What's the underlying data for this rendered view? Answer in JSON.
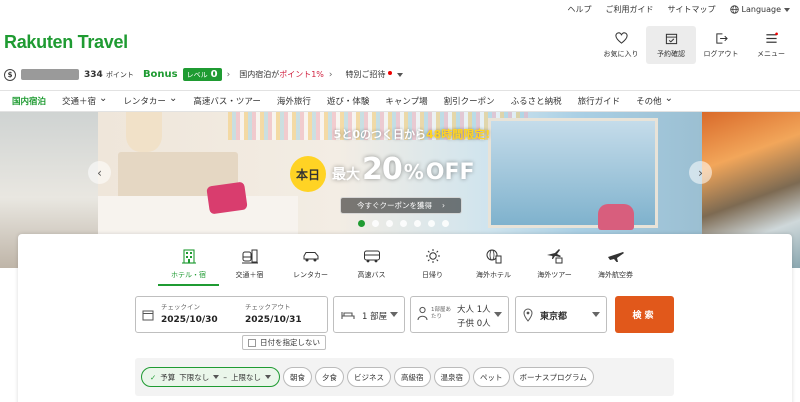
{
  "util_links": [
    "ヘルプ",
    "ご利用ガイド",
    "サイトマップ"
  ],
  "language_label": "Language",
  "logo_text": "Rakuten Travel",
  "header_buttons": [
    {
      "label": "お気に入り",
      "icon": "heart-icon"
    },
    {
      "label": "予約確認",
      "icon": "calendar-check-icon"
    },
    {
      "label": "ログアウト",
      "icon": "logout-icon"
    },
    {
      "label": "メニュー",
      "icon": "menu-icon"
    }
  ],
  "points": {
    "coin_symbol": "$",
    "value": "334",
    "unit": "ポイント",
    "bonus_label": "Bonus",
    "level_label": "レベル",
    "level_value": "0",
    "promo_prefix": "国内宿泊が",
    "promo_highlight": "ポイント1%",
    "invite_label": "特別ご招待"
  },
  "nav_items": [
    {
      "label": "国内宿泊",
      "active": true,
      "dropdown": false
    },
    {
      "label": "交通＋宿",
      "active": false,
      "dropdown": true
    },
    {
      "label": "レンタカー",
      "active": false,
      "dropdown": true
    },
    {
      "label": "高速バス・ツアー",
      "active": false,
      "dropdown": false
    },
    {
      "label": "海外旅行",
      "active": false,
      "dropdown": false
    },
    {
      "label": "遊び・体験",
      "active": false,
      "dropdown": false
    },
    {
      "label": "キャンプ場",
      "active": false,
      "dropdown": false
    },
    {
      "label": "割引クーポン",
      "active": false,
      "dropdown": false
    },
    {
      "label": "ふるさと納税",
      "active": false,
      "dropdown": false
    },
    {
      "label": "旅行ガイド",
      "active": false,
      "dropdown": false
    },
    {
      "label": "その他",
      "active": false,
      "dropdown": true
    }
  ],
  "banner": {
    "headline_prefix": "5と0のつく日から",
    "headline_highlight": "48時間限定!",
    "today_badge": "本日",
    "max_label": "最大",
    "discount_number": "20",
    "discount_percent": "%",
    "discount_off": "OFF",
    "cta_label": "今すぐクーポンを獲得",
    "slide_count": 7,
    "active_slide": 1
  },
  "search_tabs": [
    {
      "label": "ホテル・宿",
      "icon": "hotel-icon",
      "active": true
    },
    {
      "label": "交通＋宿",
      "icon": "train-hotel-icon",
      "active": false
    },
    {
      "label": "レンタカー",
      "icon": "car-icon",
      "active": false
    },
    {
      "label": "高速バス",
      "icon": "bus-icon",
      "active": false
    },
    {
      "label": "日帰り",
      "icon": "sun-icon",
      "active": false
    },
    {
      "label": "海外ホテル",
      "icon": "globe-hotel-icon",
      "active": false
    },
    {
      "label": "海外ツアー",
      "icon": "plane-hotel-icon",
      "active": false
    },
    {
      "label": "海外航空券",
      "icon": "plane-icon",
      "active": false
    }
  ],
  "search": {
    "checkin_label": "チェックイン",
    "checkin_value": "2025/10/30",
    "checkout_label": "チェックアウト",
    "checkout_value": "2025/10/31",
    "rooms_value": "1 部屋",
    "per_room_label": "1部屋あたり",
    "adults_value": "大人 1人",
    "children_value": "子供 0人",
    "destination_value": "東京都",
    "search_button": "検索",
    "no_date_label": "日付を指定しない"
  },
  "filters": {
    "budget_label": "予算",
    "budget_min": "下限なし",
    "budget_sep": "–",
    "budget_max": "上限なし",
    "chips": [
      "朝食",
      "夕食",
      "ビジネス",
      "高級宿",
      "温泉宿",
      "ペット",
      "ボーナスプログラム"
    ]
  },
  "colors": {
    "brand_green": "#1f9b32",
    "search_orange": "#e1581b",
    "promo_red": "#d1213f"
  }
}
